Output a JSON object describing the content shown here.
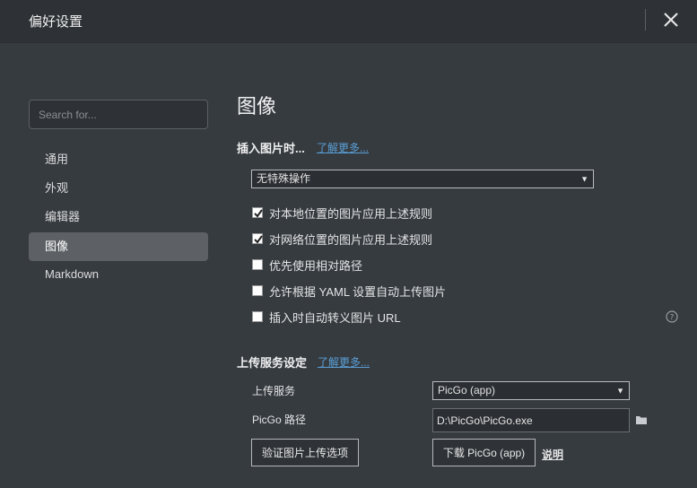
{
  "window": {
    "title": "偏好设置"
  },
  "sidebar": {
    "search_placeholder": "Search for...",
    "items": [
      {
        "label": "通用"
      },
      {
        "label": "外观"
      },
      {
        "label": "编辑器"
      },
      {
        "label": "图像",
        "active": true
      },
      {
        "label": "Markdown"
      }
    ]
  },
  "main": {
    "title": "图像",
    "insert": {
      "label": "插入图片时...",
      "learn_more": "了解更多...",
      "action_select": "无特殊操作",
      "options": [
        {
          "label": "对本地位置的图片应用上述规则",
          "checked": true
        },
        {
          "label": "对网络位置的图片应用上述规则",
          "checked": true
        },
        {
          "label": "优先使用相对路径",
          "checked": false
        },
        {
          "label": "允许根据 YAML 设置自动上传图片",
          "checked": false
        },
        {
          "label": "插入时自动转义图片 URL",
          "checked": false
        }
      ]
    },
    "upload": {
      "label": "上传服务设定",
      "learn_more": "了解更多...",
      "service_label": "上传服务",
      "service_value": "PicGo (app)",
      "path_label": "PicGo 路径",
      "path_value": "D:\\PicGo\\PicGo.exe",
      "verify_button": "验证图片上传选项",
      "download_button": "下载 PicGo (app)",
      "explain_link": "说明"
    }
  },
  "colors": {
    "background": "#363b40",
    "titlebar": "#2e3236",
    "active_item": "#5d6166",
    "link": "#5a9fd6"
  },
  "icons": [
    "close-icon",
    "dropdown-arrow-icon",
    "checkbox-checked-icon",
    "help-icon",
    "folder-icon"
  ]
}
